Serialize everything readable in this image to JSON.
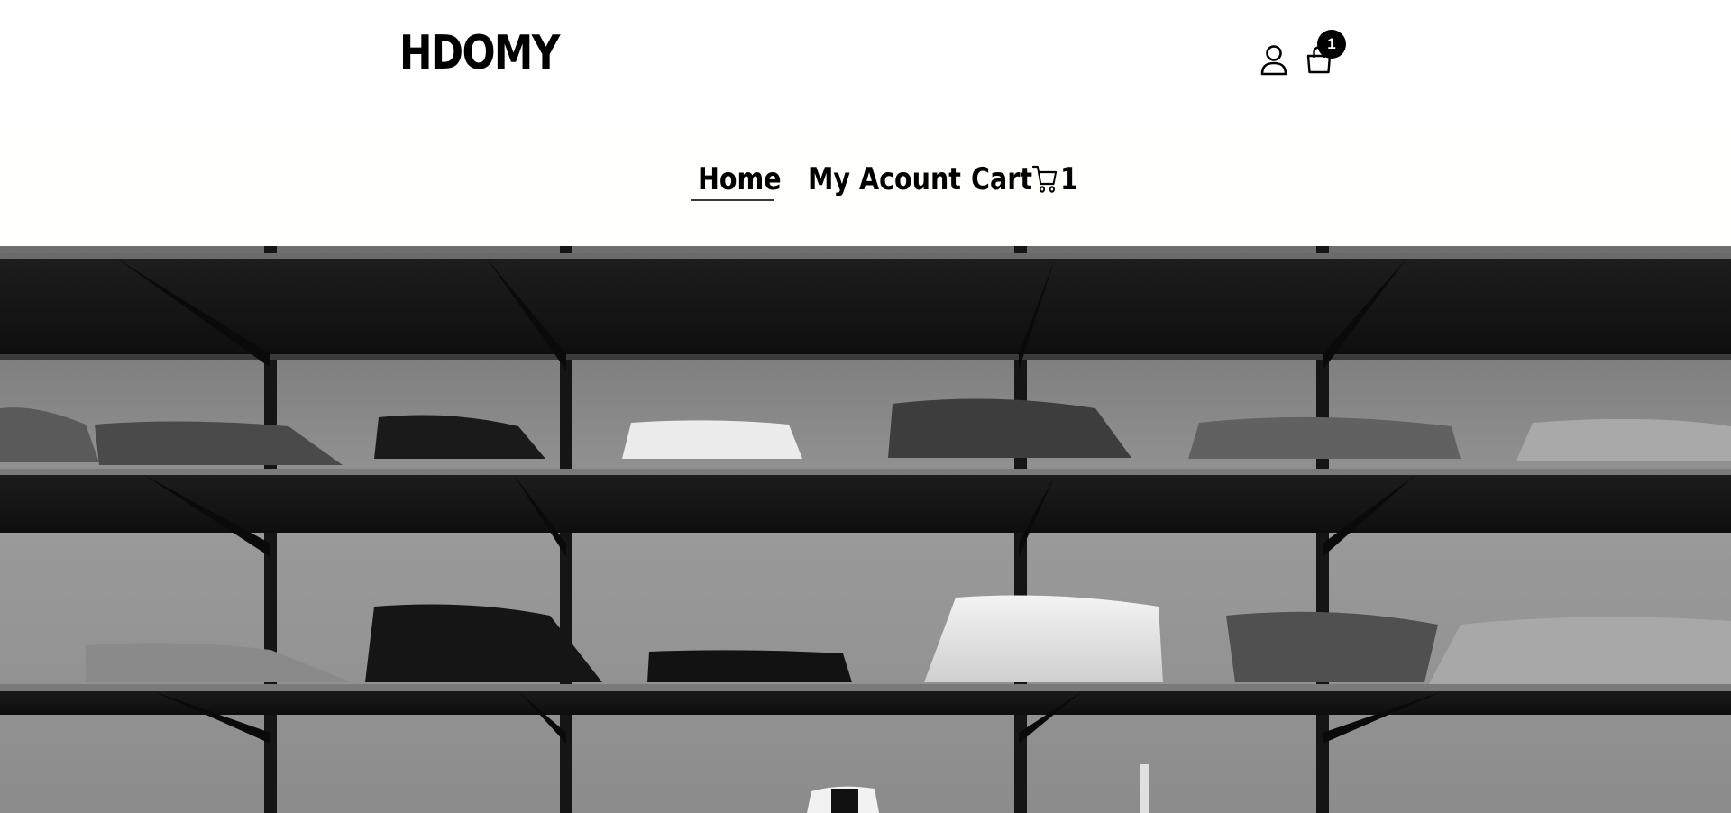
{
  "header": {
    "brand": "HDOMY",
    "cart_badge_count": "1",
    "icons": [
      "user-icon",
      "shopping-bag-icon"
    ]
  },
  "nav": {
    "items": [
      {
        "label": "Home",
        "active": true
      },
      {
        "label": "My Acount"
      },
      {
        "label": "Cart",
        "count": "1",
        "icon": "shopping-cart-icon"
      }
    ]
  },
  "hero": {
    "subject": "black-and-white photo of folded sweaters on wall shelves"
  },
  "colors": {
    "text": "#000000",
    "nav_background": "#fffffb",
    "badge": "#000000"
  }
}
